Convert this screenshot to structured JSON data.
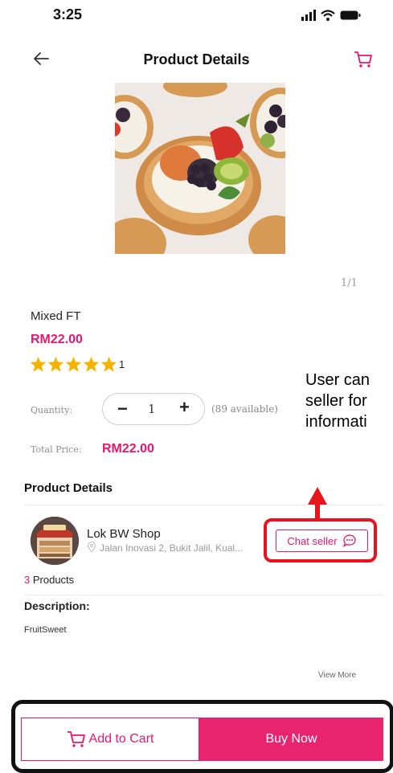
{
  "status_bar": {
    "time": "3:25"
  },
  "header": {
    "title": "Product Details"
  },
  "gallery": {
    "pager": "1/1"
  },
  "product": {
    "name": "Mixed FT",
    "price": "RM22.00",
    "rating_stars": 5,
    "rating_count": "1"
  },
  "quantity": {
    "label": "Quantity:",
    "value": "1",
    "available": "(89 available)"
  },
  "total": {
    "label": "Total Price:",
    "value": "RM22.00"
  },
  "details": {
    "section_title": "Product Details",
    "shop_name": "Lok BW Shop",
    "shop_address": "Jalan Inovasi 2, Bukit Jalil, Kual...",
    "chat_button": "Chat seller",
    "products_count": "3",
    "products_label": "Products",
    "description_title": "Description:",
    "description_text": "FruitSweet",
    "view_more": "View More"
  },
  "annotation": {
    "line1": "User can",
    "line2": "seller for",
    "line3": "informati"
  },
  "actions": {
    "add_to_cart": "Add to Cart",
    "buy_now": "Buy Now"
  },
  "colors": {
    "accent": "#e3186f",
    "buy_button": "#e8246f",
    "highlight": "#e8141b",
    "star": "#f5b301"
  },
  "icons": [
    "signal-icon",
    "wifi-icon",
    "battery-icon",
    "back-arrow-icon",
    "cart-icon",
    "star-icon",
    "location-pin-icon",
    "chat-bubble-icon"
  ]
}
